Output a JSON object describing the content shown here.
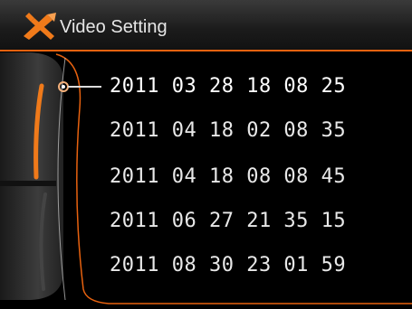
{
  "header": {
    "title": "Video Setting",
    "icon": "tools-icon"
  },
  "list": {
    "selected_index": 0,
    "items": [
      {
        "label": "2011 03 28 18 08 25"
      },
      {
        "label": "2011 04 18 02 08 35"
      },
      {
        "label": "2011 04 18 08 08 45"
      },
      {
        "label": "2011 06 27 21 35 15"
      },
      {
        "label": "2011 08 30 23 01 59"
      }
    ]
  },
  "colors": {
    "accent": "#e8620f",
    "text": "#e8e8e8",
    "background": "#000000"
  }
}
